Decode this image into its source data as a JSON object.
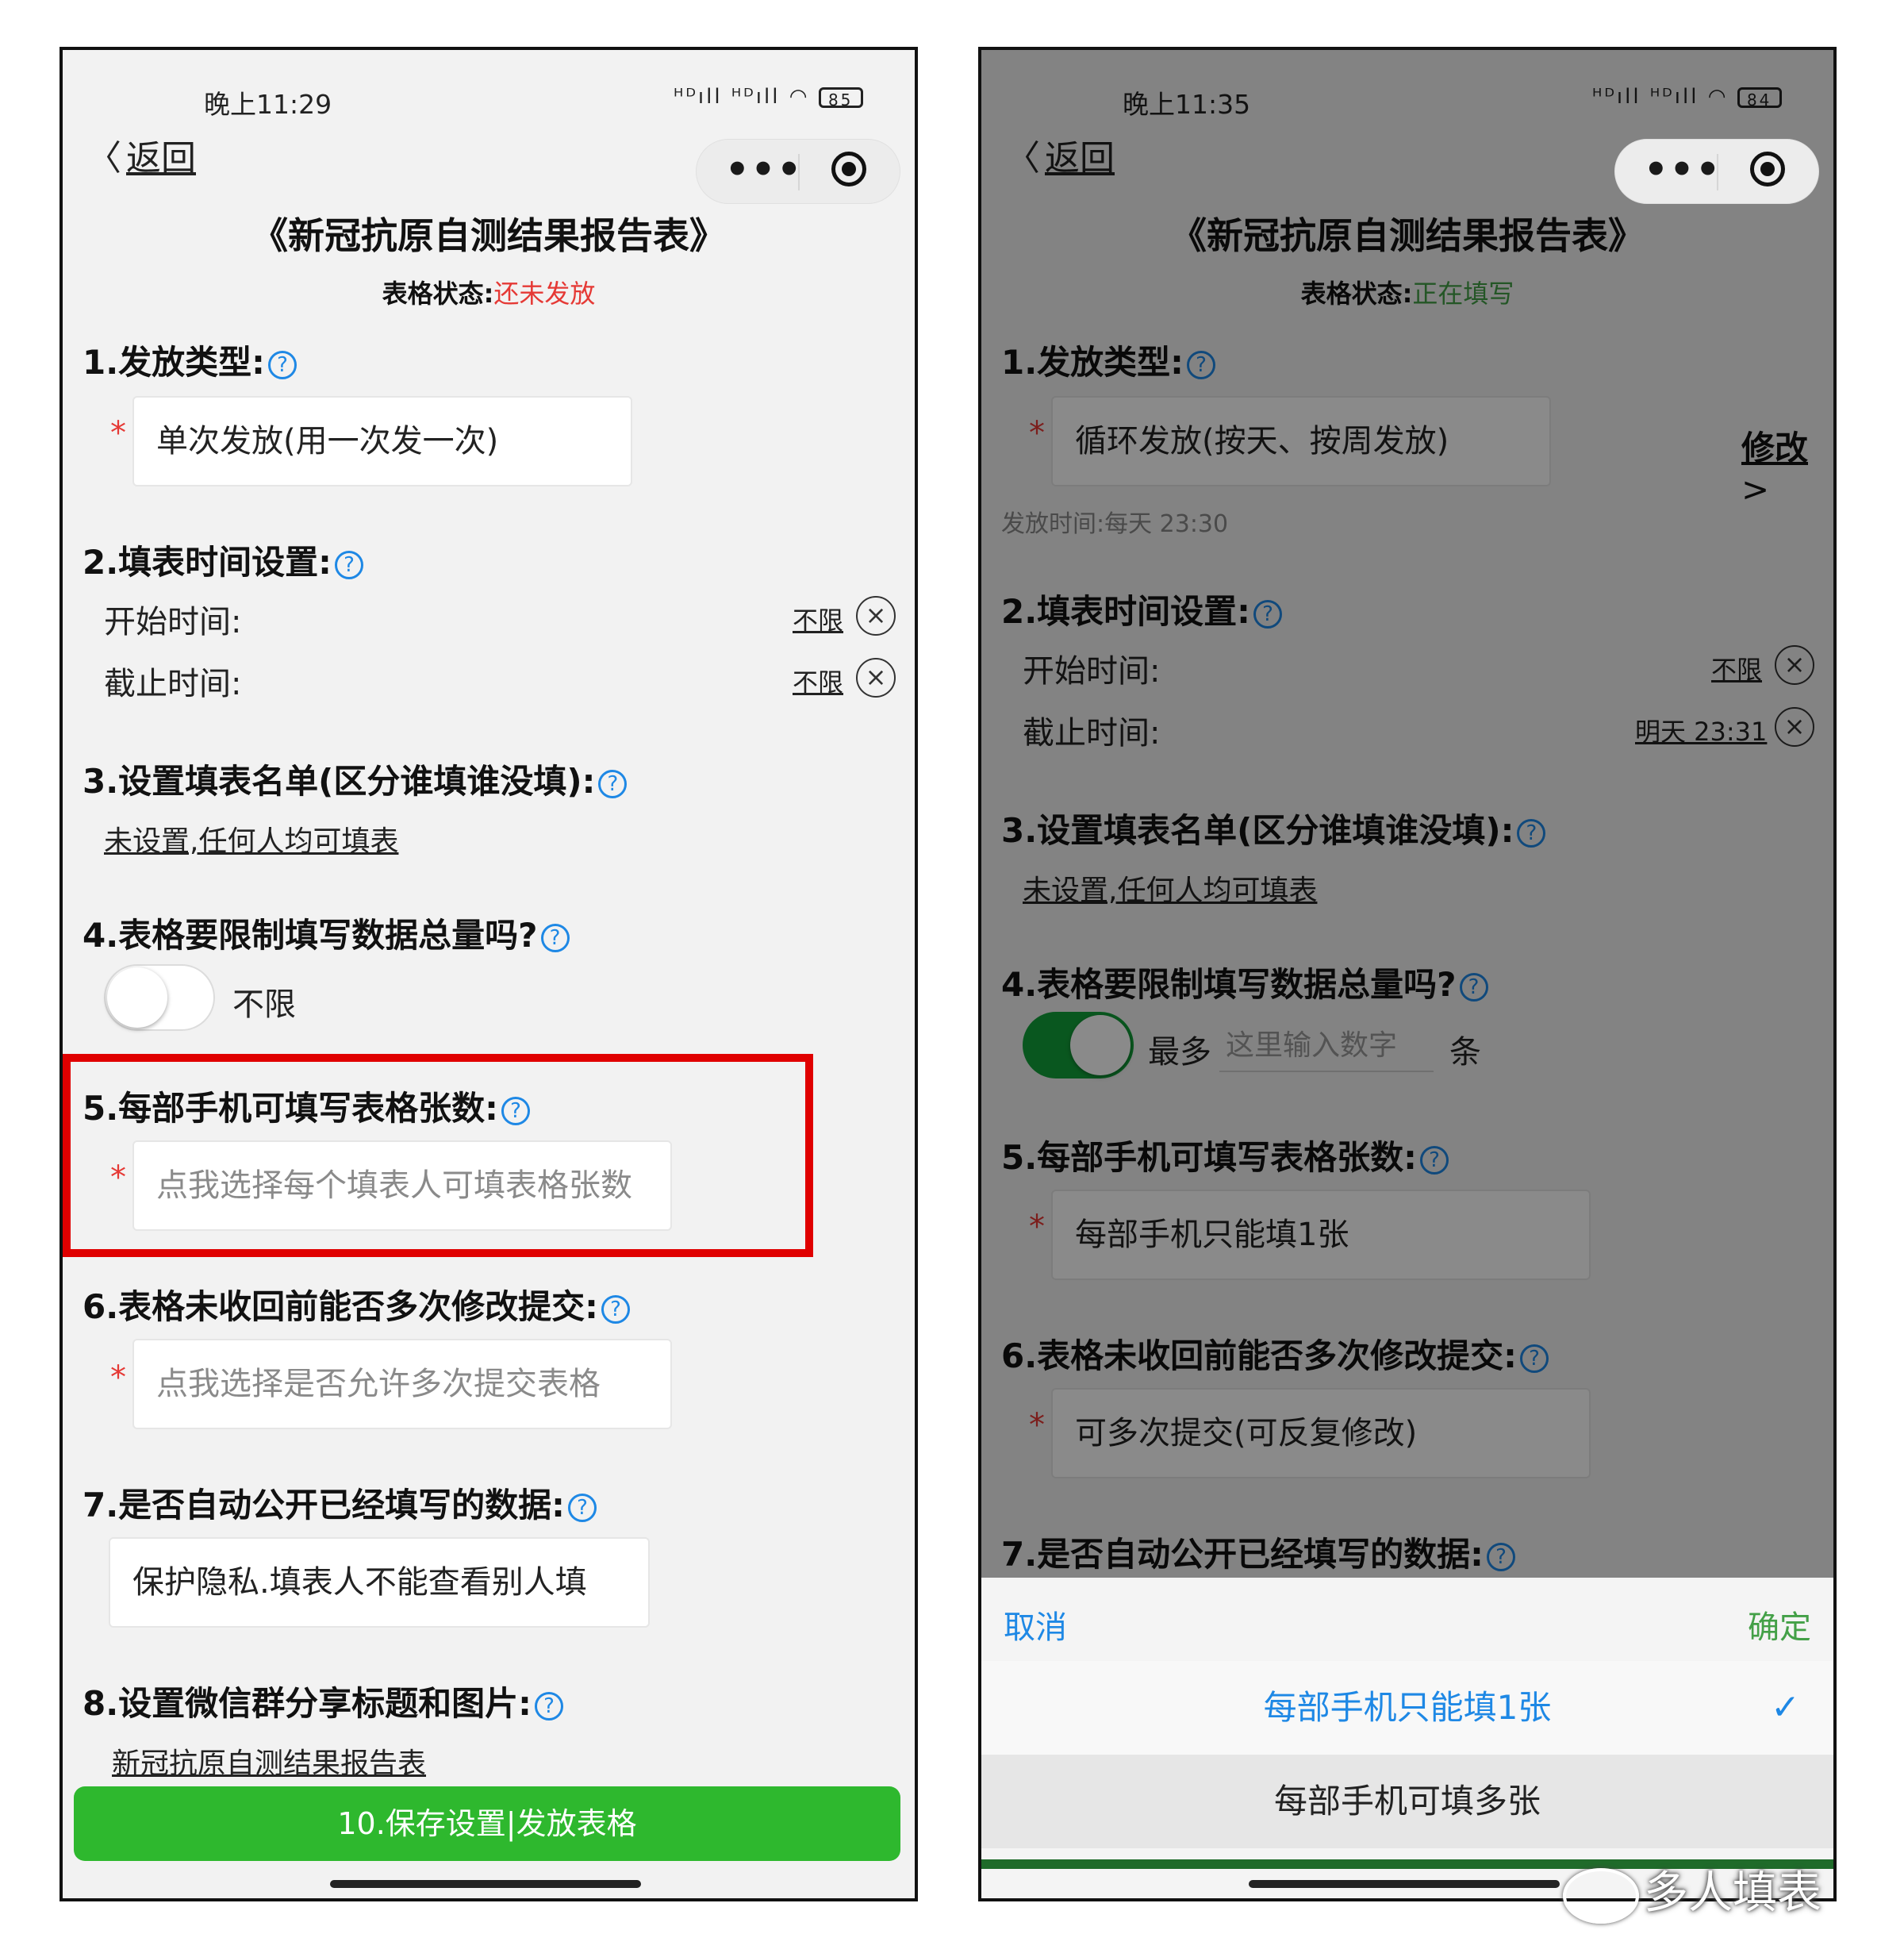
{
  "left": {
    "status_time": "晚上11:29",
    "status_icons": "ᴴᴰıll ᴴᴰıll ◠",
    "battery": "85",
    "back_label": "返回",
    "capsule_dots": "•••",
    "title": "《新冠抗原自测结果报告表》",
    "state_label": "表格状态:",
    "state_value": "还未发放",
    "sections": {
      "s1": "1.发放类型:",
      "s2": "2.填表时间设置:",
      "s3": "3.设置填表名单(区分谁填谁没填):",
      "s4": "4.表格要限制填写数据总量吗?",
      "s5": "5.每部手机可填写表格张数:",
      "s6": "6.表格未收回前能否多次修改提交:",
      "s7": "7.是否自动公开已经填写的数据:",
      "s8": "8.设置微信群分享标题和图片:"
    },
    "star": "*",
    "help": "?",
    "x": "×",
    "f1_value": "单次发放(用一次发一次)",
    "start_label": "开始时间:",
    "start_value": "不限",
    "end_label": "截止时间:",
    "end_value": "不限",
    "list_link": "未设置,任何人均可填表",
    "limit_text": "不限",
    "f5_placeholder": "点我选择每个填表人可填表格张数",
    "f6_placeholder": "点我选择是否允许多次提交表格",
    "f7_value": "保护隐私.填表人不能查看别人填",
    "share_link": "新冠抗原自测结果报告表",
    "save_button": "10.保存设置|发放表格"
  },
  "right": {
    "status_time": "晚上11:35",
    "status_icons": "ᴴᴰıll ᴴᴰıll ◠",
    "battery": "84",
    "back_label": "返回",
    "capsule_dots": "•••",
    "title": "《新冠抗原自测结果报告表》",
    "state_label": "表格状态:",
    "state_value": "正在填写",
    "sections": {
      "s1": "1.发放类型:",
      "s2": "2.填表时间设置:",
      "s3": "3.设置填表名单(区分谁填谁没填):",
      "s4": "4.表格要限制填写数据总量吗?",
      "s5": "5.每部手机可填写表格张数:",
      "s6": "6.表格未收回前能否多次修改提交:",
      "s7": "7.是否自动公开已经填写的数据:"
    },
    "star": "*",
    "help": "?",
    "x": "×",
    "f1_value": "循环发放(按天、按周发放)",
    "modify_link": "修改",
    "modify_arrow": ">",
    "issue_time": "发放时间:每天 23:30",
    "start_label": "开始时间:",
    "start_value": "不限",
    "end_label": "截止时间:",
    "end_value": "明天 23:31",
    "list_link": "未设置,任何人均可填表",
    "max_prefix": "最多",
    "max_placeholder": "这里输入数字",
    "max_suffix": "条",
    "f5_value": "每部手机只能填1张",
    "f6_value": "可多次提交(可反复修改)",
    "sheet": {
      "cancel": "取消",
      "confirm": "确定",
      "option1": "每部手机只能填1张",
      "option2": "每部手机可填多张",
      "check": "✓"
    }
  },
  "watermark": "多人填表",
  "colors": {
    "accent_blue": "#1e88e5",
    "required_red": "#e53935",
    "status_red": "#e53935",
    "status_green": "#43a047",
    "toggle_green": "#12a23a",
    "save_green": "#2eb82e",
    "highlight_box": "#e00000"
  }
}
